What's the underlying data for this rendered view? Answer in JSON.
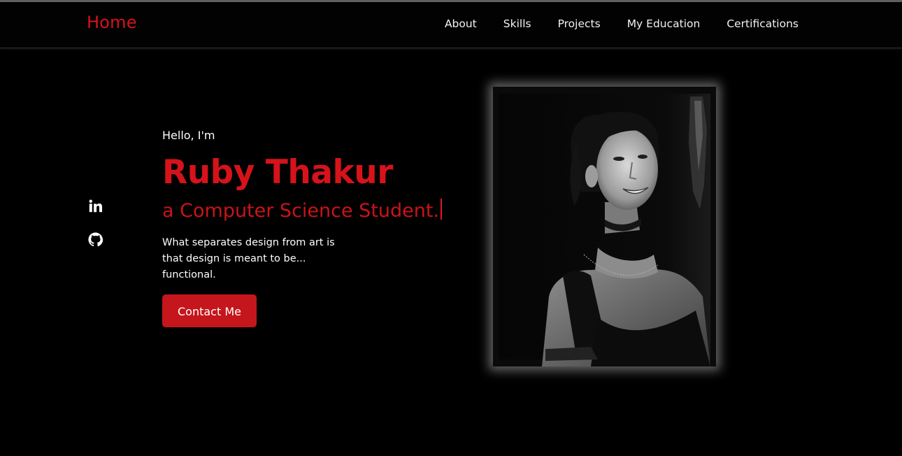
{
  "nav": {
    "brand": "Home",
    "links": [
      "About",
      "Skills",
      "Projects",
      "My Education",
      "Certifications"
    ]
  },
  "social": {
    "linkedin_icon": "linkedin-icon",
    "github_icon": "github-icon"
  },
  "hero": {
    "greeting": "Hello, I'm",
    "name": "Ruby Thakur",
    "role": "a Computer Science Student.",
    "tagline": "What separates design from art is that design is meant to be... functional.",
    "cta": "Contact Me"
  },
  "colors": {
    "accent": "#d6131a",
    "background": "#000000",
    "text": "#ffffff"
  }
}
